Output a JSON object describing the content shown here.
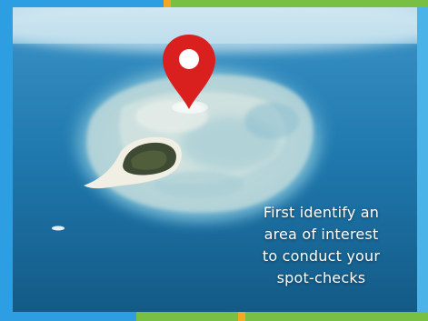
{
  "caption": {
    "lines": [
      "First identify an",
      "area of interest",
      "to conduct your",
      "spot-checks"
    ]
  },
  "colors": {
    "pin": "#d9201f",
    "ocean_deep": "#1c6f9c",
    "reef_light": "#cfe3e3",
    "frame_blue": "#2e9ee3",
    "frame_green": "#78c043",
    "frame_orange": "#f5a623"
  },
  "icons": {
    "pin": "map-pin-icon"
  }
}
